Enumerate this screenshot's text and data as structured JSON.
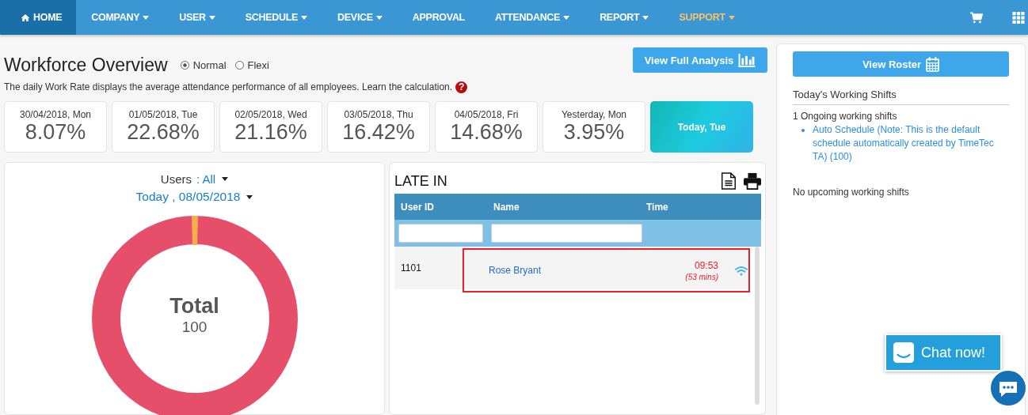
{
  "nav": {
    "items": [
      {
        "label": "HOME",
        "dropdown": false,
        "selected": true,
        "highlighted": false
      },
      {
        "label": "COMPANY",
        "dropdown": true,
        "selected": false,
        "highlighted": false
      },
      {
        "label": "USER",
        "dropdown": true,
        "selected": false,
        "highlighted": false
      },
      {
        "label": "SCHEDULE",
        "dropdown": true,
        "selected": false,
        "highlighted": false
      },
      {
        "label": "DEVICE",
        "dropdown": true,
        "selected": false,
        "highlighted": false
      },
      {
        "label": "APPROVAL",
        "dropdown": false,
        "selected": false,
        "highlighted": false
      },
      {
        "label": "ATTENDANCE",
        "dropdown": true,
        "selected": false,
        "highlighted": false
      },
      {
        "label": "REPORT",
        "dropdown": true,
        "selected": false,
        "highlighted": false
      },
      {
        "label": "SUPPORT",
        "dropdown": true,
        "selected": false,
        "highlighted": true
      }
    ]
  },
  "header": {
    "title": "Workforce Overview",
    "modes": [
      {
        "label": "Normal",
        "selected": true
      },
      {
        "label": "Flexi",
        "selected": false
      }
    ],
    "description": "The daily Work Rate displays the average attendance performance of all employees. Learn the calculation.",
    "help_symbol": "?",
    "analysis_button": "View Full Analysis"
  },
  "day_cards": [
    {
      "date": "30/04/2018, Mon",
      "rate": "8.07%"
    },
    {
      "date": "01/05/2018, Tue",
      "rate": "22.68%"
    },
    {
      "date": "02/05/2018, Wed",
      "rate": "21.16%"
    },
    {
      "date": "03/05/2018, Thu",
      "rate": "16.42%"
    },
    {
      "date": "04/05/2018, Fri",
      "rate": "14.68%"
    },
    {
      "date": "Yesterday, Mon",
      "rate": "3.95%"
    }
  ],
  "today_card": {
    "label": "Today, Tue"
  },
  "overview": {
    "users_label": "Users",
    "users_value": ": All",
    "date": "Today , 08/05/2018",
    "center_title": "Total",
    "center_value": "100"
  },
  "late_in": {
    "title": "LATE IN",
    "columns": [
      "User ID",
      "Name",
      "Time"
    ],
    "rows": [
      {
        "user_id": "1101",
        "name": "Rose Bryant",
        "time": "09:53",
        "late_by": "(53 mins)",
        "highlighted": true
      }
    ]
  },
  "roster": {
    "button": "View Roster",
    "section_title": "Today's Working Shifts",
    "ongoing": "1 Ongoing working shifts",
    "shifts": [
      "Auto Schedule (Note: This is the default schedule automatically created by TimeTec TA) (100)"
    ],
    "upcoming": "No upcoming working shifts"
  },
  "chat": {
    "label": "Chat now!"
  }
}
